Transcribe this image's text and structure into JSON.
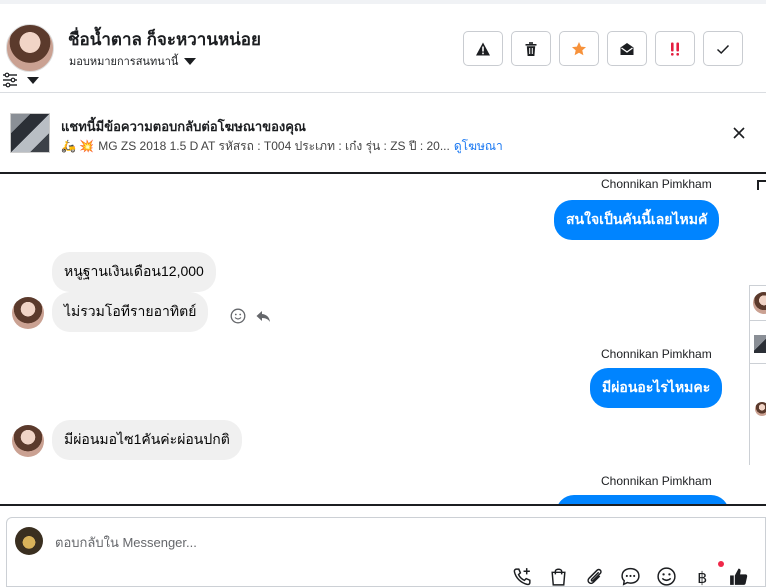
{
  "header": {
    "contact_name": "ชื่อน้ำตาล ก็จะหวานหน่อย",
    "assign_label": "มอบหมายการสนทนานี้",
    "actions": [
      {
        "name": "report-button",
        "icon": "warning-icon"
      },
      {
        "name": "delete-button",
        "icon": "trash-icon"
      },
      {
        "name": "star-button",
        "icon": "star-icon"
      },
      {
        "name": "mark-unread-button",
        "icon": "envelope-open-icon"
      },
      {
        "name": "follow-up-button",
        "icon": "double-exclamation-icon"
      },
      {
        "name": "mark-done-button",
        "icon": "check-icon"
      }
    ]
  },
  "ad": {
    "title": "แชทนี้มีข้อความตอบกลับต่อโฆษณาของคุณ",
    "emoji": "🛵 💥",
    "subtitle": "MG ZS 2018 1.5 D AT รหัสรถ : T004 ประเภท : เก๋ง รุ่น : ZS ปี : 20...",
    "link": "ดูโฆษณา"
  },
  "messages": {
    "sender_1": "Chonnikan Pimkham",
    "out_1": "สนใจเป็นคันนี้เลยไหมคั",
    "in_1": "หนูฐานเงินเดือน12,000",
    "in_2": "ไม่รวมโอทีรายอาทิตย์",
    "sender_2": "Chonnikan Pimkham",
    "out_2": "มีผ่อนอะไรไหมคะ",
    "in_3": "มีผ่อนมอไซ1คันค่ะผ่อนปกติ",
    "sender_3": "Chonnikan Pimkham"
  },
  "composer": {
    "placeholder": "ตอบกลับใน Messenger...",
    "value": ""
  },
  "colors": {
    "accent": "#0084ff",
    "star": "#f7923b",
    "alert": "#e41e3f"
  }
}
